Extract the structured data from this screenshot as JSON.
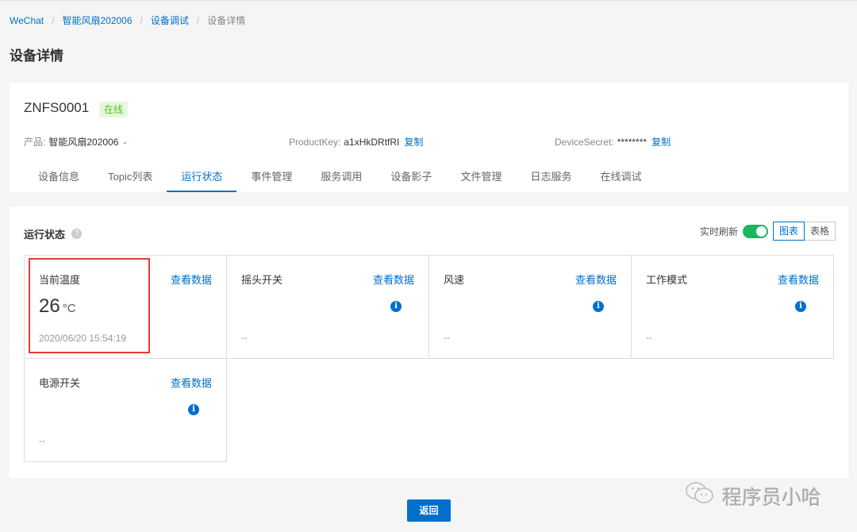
{
  "breadcrumb": [
    {
      "label": "WeChat",
      "link": true
    },
    {
      "label": "智能风扇202006",
      "link": true
    },
    {
      "label": "设备调试",
      "link": true
    },
    {
      "label": "设备详情",
      "link": false
    }
  ],
  "page_title": "设备详情",
  "device": {
    "name": "ZNFS0001",
    "status": "在线",
    "status_color": "#52c41a",
    "product_label": "产品:",
    "product_value": "智能风扇202006",
    "product_link": "-",
    "productkey_label": "ProductKey:",
    "productkey_value": "a1xHkDRtfRI",
    "productkey_copy": "复制",
    "secret_label": "DeviceSecret:",
    "secret_value": "********",
    "secret_copy": "复制"
  },
  "tabs": [
    {
      "label": "设备信息",
      "active": false
    },
    {
      "label": "Topic列表",
      "active": false
    },
    {
      "label": "运行状态",
      "active": true
    },
    {
      "label": "事件管理",
      "active": false
    },
    {
      "label": "服务调用",
      "active": false
    },
    {
      "label": "设备影子",
      "active": false
    },
    {
      "label": "文件管理",
      "active": false
    },
    {
      "label": "日志服务",
      "active": false
    },
    {
      "label": "在线调试",
      "active": false
    }
  ],
  "status_section": {
    "title": "运行状态",
    "realtime_label": "实时刷新",
    "realtime_on": true,
    "view_chart": "图表",
    "view_table": "表格"
  },
  "properties": [
    {
      "name": "当前温度",
      "view": "查看数据",
      "value": "26",
      "unit": "°C",
      "timestamp": "2020/06/20 15:54:19"
    },
    {
      "name": "摇头开关",
      "view": "查看数据",
      "empty": "--"
    },
    {
      "name": "风速",
      "view": "查看数据",
      "empty": "--"
    },
    {
      "name": "工作模式",
      "view": "查看数据",
      "empty": "--"
    },
    {
      "name": "电源开关",
      "view": "查看数据",
      "empty": "--"
    }
  ],
  "back_button": "返回",
  "watermark": "程序员小哈",
  "accent_color": "#0070cc"
}
